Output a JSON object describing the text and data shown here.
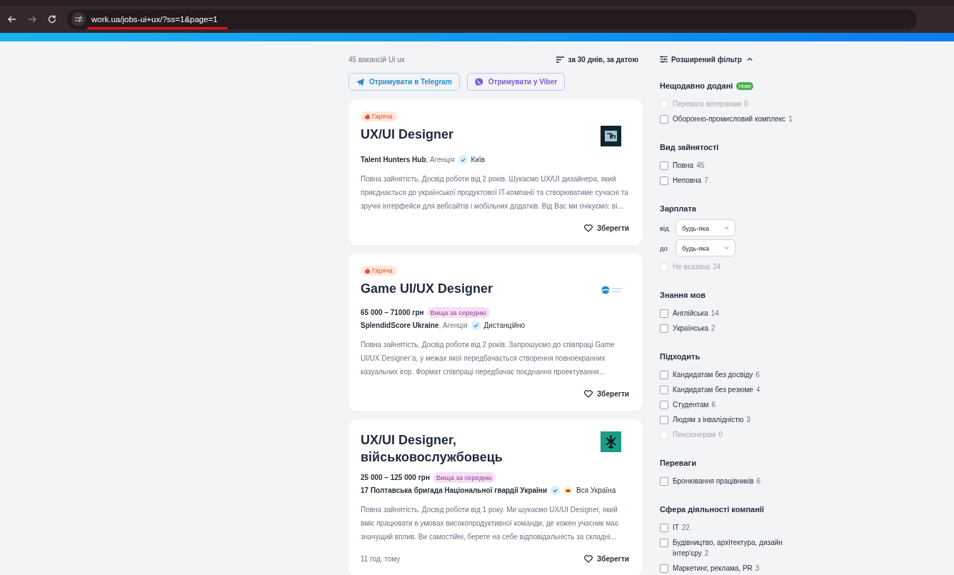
{
  "browser": {
    "url": "work.ua/jobs-ui+ux/?ss=1&page=1"
  },
  "results": {
    "count": "45 вакансій Ui ux",
    "sort": "за 30 днів, за датою"
  },
  "subscribe": [
    {
      "kind": "telegram",
      "label": "Отримувати в Telegram"
    },
    {
      "kind": "viber",
      "label": "Отримувати у Viber"
    }
  ],
  "jobs": [
    {
      "hot": "Гаряча",
      "title": "UX/UI Designer",
      "logo": {
        "kind": "square"
      },
      "company": "Talent Hunters Hub",
      "company_type": ", Агенція",
      "verified": true,
      "location": "Київ",
      "description": "Повна зайнятість. Досвід роботи від 2 років. Шукаємо UX/UI дизайнера, який приєднається до української продуктової IT-компанії та створюватиме сучасні та зручні інтерфейси для вебсайтів і мобільних додатків. Від Вас ми очікуємо: ві...",
      "save": "Зберегти"
    },
    {
      "hot": "Гаряча",
      "title": "Game UI/UX Designer",
      "logo": {
        "kind": "wave"
      },
      "salary": "65 000 – 71000 грн",
      "salary_badge": "Вища за середню",
      "company": "SplendidScore Ukraine",
      "company_type": ", Агенція",
      "verified": true,
      "location": "Дистанційно",
      "description": "Повна зайнятість. Досвід роботи від 2 років. Запрошуємо до співпраці Game UI/UX Designer’a, у межах якої передбачається створення повноекранних казуальних ігор. Формат співпраці передбачає поєднання проектування...",
      "save": "Зберегти"
    },
    {
      "title": "UX/UI Designer, військовослужбовець",
      "logo": {
        "kind": "emblem"
      },
      "salary": "25 000 – 125 000 грн",
      "salary_badge": "Вища за середню",
      "company": "17 Полтавська бригада Національної гвардії України",
      "verified": true,
      "premium": true,
      "location": "Вся Україна",
      "description": "Повна зайнятість. Досвід роботи від 1 року. Ми шукаємо UX/UI Designer, який вміє працювати в умовах високопродуктивної команди, де кожен учасник має значущий вплив. Ви самостійні, берете на себе відповідальність за складні...",
      "time": "11 год. тому",
      "save": "Зберегти"
    }
  ],
  "filter": {
    "title": "Розширений фільтр",
    "expanded": true,
    "sections": [
      {
        "title": "Нещодавно додані",
        "badge": "Нове",
        "items": [
          {
            "kind": "checkbox",
            "label": "Перевага ветеранам",
            "count": "0",
            "checked": false,
            "disabled": true
          },
          {
            "kind": "checkbox",
            "label": "Оборонно-промисловий комплекс",
            "count": "1",
            "checked": false,
            "disabled": false
          }
        ]
      },
      {
        "title": "Вид зайнятості",
        "items": [
          {
            "kind": "checkbox",
            "label": "Повна",
            "count": "45",
            "checked": false,
            "disabled": false
          },
          {
            "kind": "checkbox",
            "label": "Неповна",
            "count": "7",
            "checked": false,
            "disabled": false
          }
        ]
      },
      {
        "title": "Зарплата",
        "items": [
          {
            "kind": "select",
            "prefix": "від",
            "value": "будь-яка"
          },
          {
            "kind": "select",
            "prefix": "до",
            "value": "будь-яка"
          },
          {
            "kind": "checkbox",
            "label": "Не вказана",
            "count": "24",
            "checked": false,
            "disabled": true
          }
        ]
      },
      {
        "title": "Знання мов",
        "items": [
          {
            "kind": "checkbox",
            "label": "Англійська",
            "count": "14",
            "checked": false,
            "disabled": false
          },
          {
            "kind": "checkbox",
            "label": "Українська",
            "count": "2",
            "checked": false,
            "disabled": false
          }
        ]
      },
      {
        "title": "Підходить",
        "items": [
          {
            "kind": "checkbox",
            "label": "Кандидатам без досвіду",
            "count": "6",
            "checked": false,
            "disabled": false
          },
          {
            "kind": "checkbox",
            "label": "Кандидатам без резюме",
            "count": "4",
            "checked": false,
            "disabled": false
          },
          {
            "kind": "checkbox",
            "label": "Студентам",
            "count": "6",
            "checked": false,
            "disabled": false
          },
          {
            "kind": "checkbox",
            "label": "Людям з інвалідністю",
            "count": "3",
            "checked": false,
            "disabled": false
          },
          {
            "kind": "checkbox",
            "label": "Пенсіонерам",
            "count": "0",
            "checked": false,
            "disabled": true
          }
        ]
      },
      {
        "title": "Переваги",
        "items": [
          {
            "kind": "checkbox",
            "label": "Бронювання працівників",
            "count": "6",
            "checked": false,
            "disabled": false
          }
        ]
      },
      {
        "title": "Сфера діяльності компанії",
        "items": [
          {
            "kind": "checkbox",
            "label": "IT",
            "count": "22",
            "checked": false,
            "disabled": false
          },
          {
            "kind": "checkbox",
            "label": "Будівництво, архітектура, дизайн інтер'єру",
            "count": "2",
            "checked": false,
            "disabled": false
          },
          {
            "kind": "checkbox",
            "label": "Маркетинг, реклама, PR",
            "count": "3",
            "checked": false,
            "disabled": false
          }
        ]
      }
    ]
  }
}
